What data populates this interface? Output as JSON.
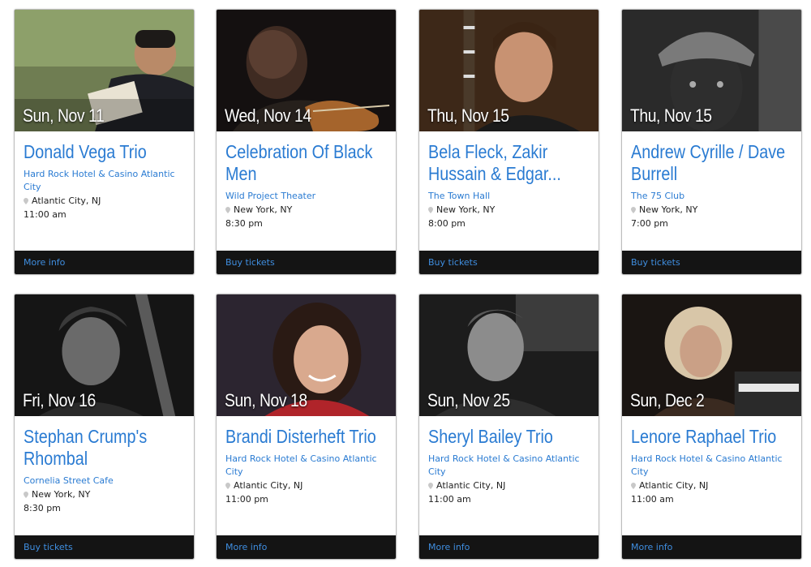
{
  "colors": {
    "accent": "#2a7bd2",
    "footer_bg": "#141414",
    "footer_link": "#3f8ee0"
  },
  "events": [
    {
      "date": "Sun, Nov 11",
      "title": "Donald Vega Trio",
      "venue": "Hard Rock Hotel & Casino Atlantic City",
      "location": "Atlantic City, NJ",
      "time": "11:00 am",
      "action": "More info",
      "icon": "map-pin-icon"
    },
    {
      "date": "Wed, Nov 14",
      "title": "Celebration Of Black Men",
      "venue": "Wild Project Theater",
      "location": "New York, NY",
      "time": "8:30 pm",
      "action": "Buy tickets",
      "icon": "map-pin-icon"
    },
    {
      "date": "Thu, Nov 15",
      "title": "Bela Fleck, Zakir Hussain & Edgar...",
      "venue": "The Town Hall",
      "location": "New York, NY",
      "time": "8:00 pm",
      "action": "Buy tickets",
      "icon": "map-pin-icon"
    },
    {
      "date": "Thu, Nov 15",
      "title": "Andrew Cyrille / Dave Burrell",
      "venue": "The 75 Club",
      "location": "New York, NY",
      "time": "7:00 pm",
      "action": "Buy tickets",
      "icon": "map-pin-icon"
    },
    {
      "date": "Fri, Nov 16",
      "title": "Stephan Crump's Rhombal",
      "venue": "Cornelia Street Cafe",
      "location": "New York, NY",
      "time": "8:30 pm",
      "action": "Buy tickets",
      "icon": "map-pin-icon"
    },
    {
      "date": "Sun, Nov 18",
      "title": "Brandi Disterheft Trio",
      "venue": "Hard Rock Hotel & Casino Atlantic City",
      "location": "Atlantic City, NJ",
      "time": "11:00 pm",
      "action": "More info",
      "icon": "map-pin-icon"
    },
    {
      "date": "Sun, Nov 25",
      "title": "Sheryl Bailey Trio",
      "venue": "Hard Rock Hotel & Casino Atlantic City",
      "location": "Atlantic City, NJ",
      "time": "11:00 am",
      "action": "More info",
      "icon": "map-pin-icon"
    },
    {
      "date": "Sun, Dec 2",
      "title": "Lenore Raphael Trio",
      "venue": "Hard Rock Hotel & Casino Atlantic City",
      "location": "Atlantic City, NJ",
      "time": "11:00 am",
      "action": "More info",
      "icon": "map-pin-icon"
    }
  ]
}
